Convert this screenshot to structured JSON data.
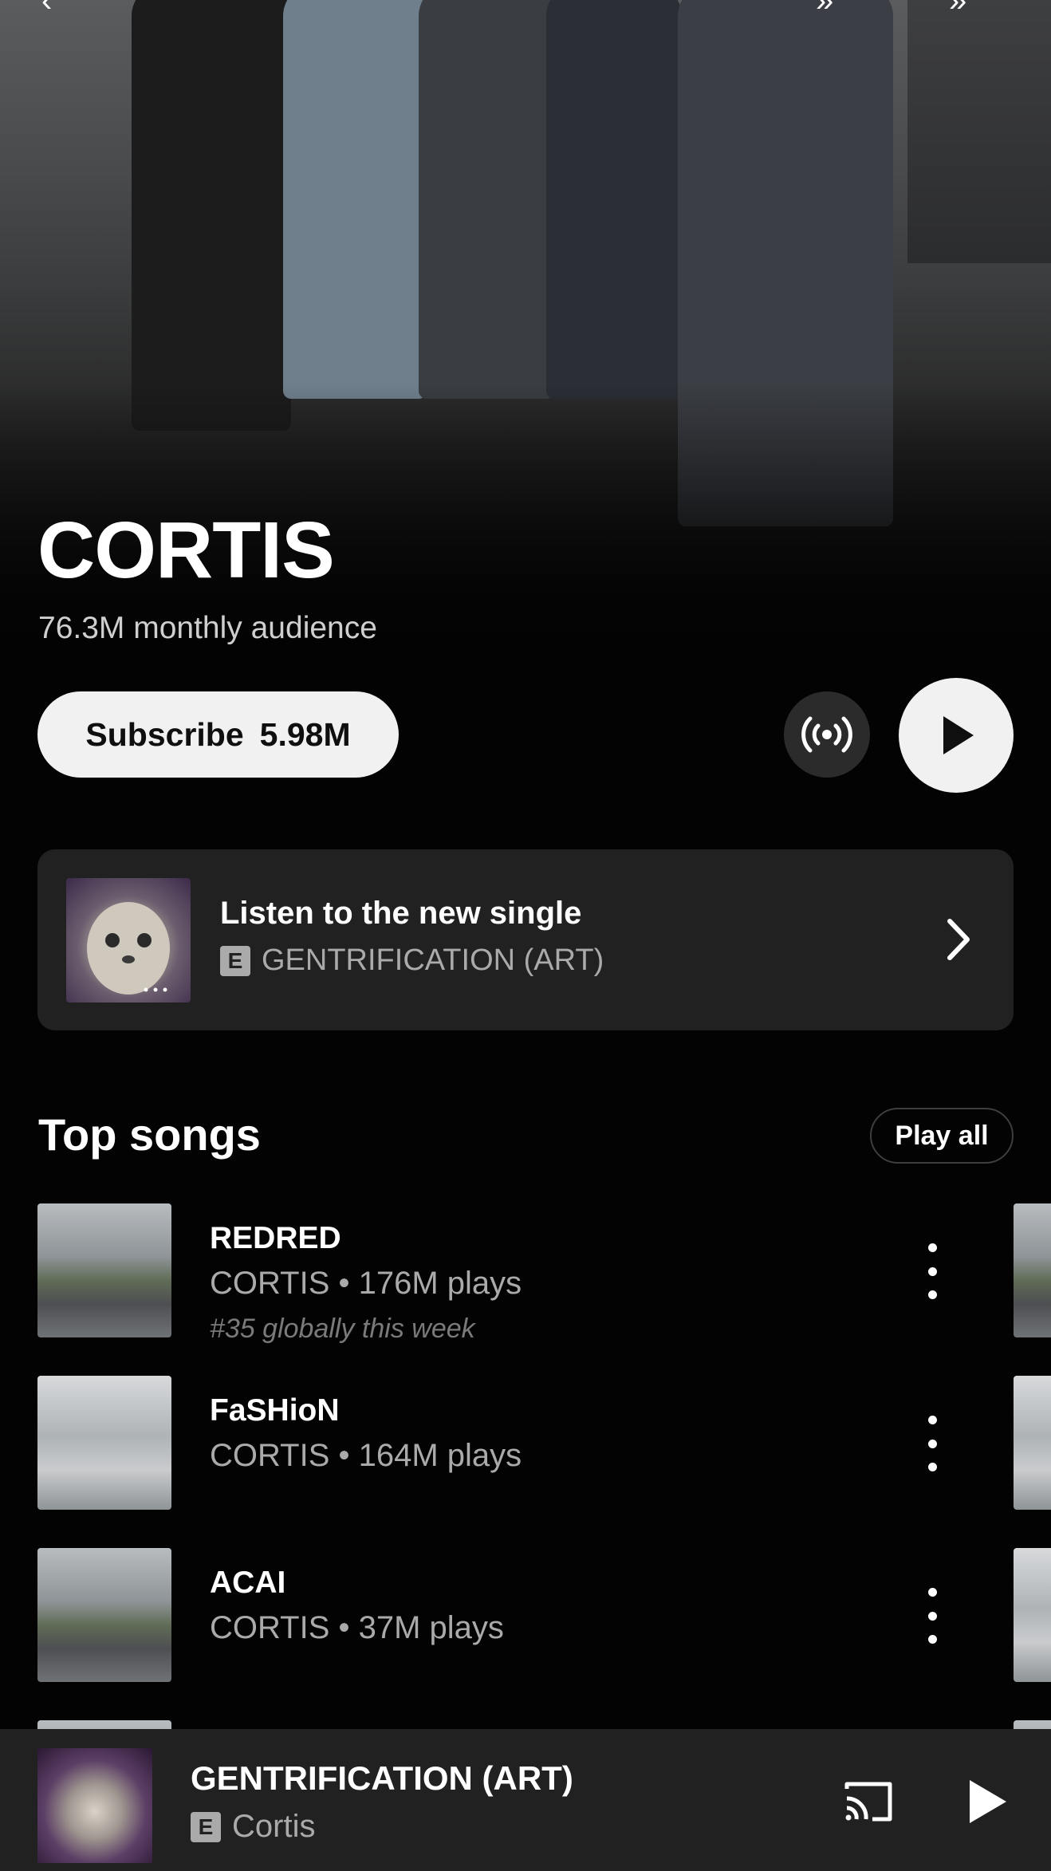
{
  "artist": {
    "name": "CORTIS",
    "audience": "76.3M monthly audience"
  },
  "actions": {
    "subscribe_label": "Subscribe",
    "subscribe_count": "5.98M"
  },
  "new_single": {
    "heading": "Listen to the new single",
    "explicit_badge": "E",
    "title": "GENTRIFICATION (ART)"
  },
  "top_songs": {
    "title": "Top songs",
    "play_all_label": "Play all",
    "items": [
      {
        "title": "REDRED",
        "meta": "CORTIS • 176M plays",
        "rank": "#35 globally this week"
      },
      {
        "title": "FaSHioN",
        "meta": "CORTIS • 164M plays",
        "rank": ""
      },
      {
        "title": "ACAI",
        "meta": "CORTIS • 37M plays",
        "rank": ""
      }
    ]
  },
  "mini_player": {
    "title": "GENTRIFICATION (ART)",
    "explicit_badge": "E",
    "artist": "Cortis"
  }
}
